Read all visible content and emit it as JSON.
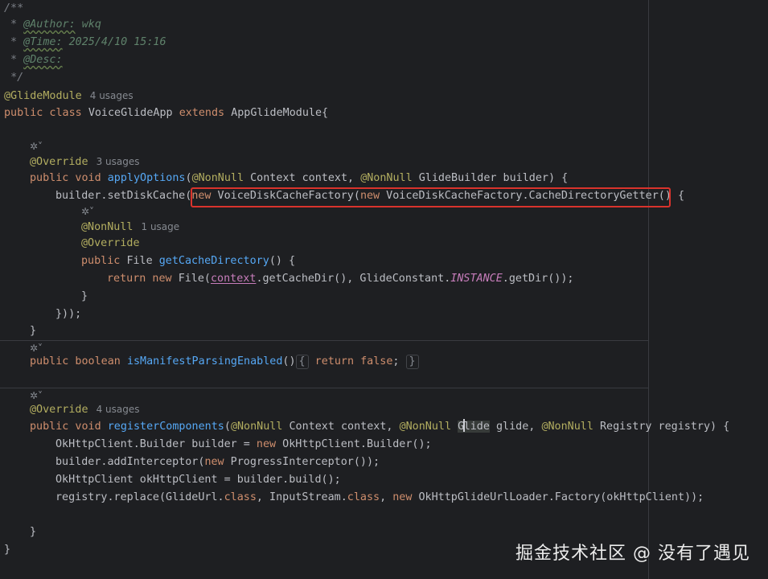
{
  "code": {
    "doc_open": "/**",
    "author_tag": "@Author:",
    "author_val": "wkq",
    "time_tag": "@Time:",
    "time_val": "2025/4/10 15:16",
    "desc_tag": "@Desc:",
    "doc_close": "*/",
    "glide_module": "@GlideModule",
    "glide_module_usages": "4 usages",
    "class_decl_kw1": "public class",
    "class_name": "VoiceGlideApp",
    "extends_kw": "extends",
    "super_name": "AppGlideModule{",
    "override": "@Override",
    "apply_usages": "3 usages",
    "apply_kw": "public void",
    "apply_name": "applyOptions",
    "apply_params": "(@NonNull Context context, @NonNull GlideBuilder builder) {",
    "set_disk_cache": "builder.setDiskCache(",
    "new_factory": "new VoiceDiskCacheFactory(new VoiceDiskCacheFactory.CacheDirectoryGetter()",
    "open_brace": "{",
    "nonnull": "@NonNull",
    "nonnull_usage": "1 usage",
    "file_kw": "public",
    "file_type": "File",
    "get_cache_dir": "getCacheDirectory",
    "get_cache_dir_tail": "() {",
    "return_kw": "return new",
    "return_file": "File(",
    "context_field": "context",
    "return_mid": ".getCacheDir(), GlideConstant.",
    "instance": "INSTANCE",
    "return_tail": ".getDir());",
    "close_brace": "}",
    "close_call": "}));",
    "manifest_kw1": "public boolean",
    "manifest_name": "isManifestParsingEnabled",
    "manifest_parens": "()",
    "manifest_fold_open": "{",
    "manifest_return": "return false",
    "manifest_fold_close": "}",
    "register_usages": "4 usages",
    "register_name": "registerComponents",
    "register_params": "(@NonNull Context context, @NonNull Glide glide, @NonNull Registry registry) {",
    "ok_builder": "OkHttpClient.Builder builder = new OkHttpClient.Builder();",
    "add_interceptor": "builder.addInterceptor(new ProgressInterceptor());",
    "ok_client": "OkHttpClient okHttpClient = builder.build();",
    "registry_replace": "registry.replace(GlideUrl.class, InputStream.class, new OkHttpGlideUrlLoader.Factory(okHttpClient));",
    "inner_close": "}",
    "class_close": "}"
  },
  "lens_label": "✲˅",
  "watermark": "掘金技术社区 @ 没有了遇见",
  "colors": {
    "background": "#1e1f22",
    "keyword": "#cf8e6d",
    "annotation": "#b3ae60",
    "method": "#56a8f5",
    "highlight_box": "#d9332c"
  }
}
